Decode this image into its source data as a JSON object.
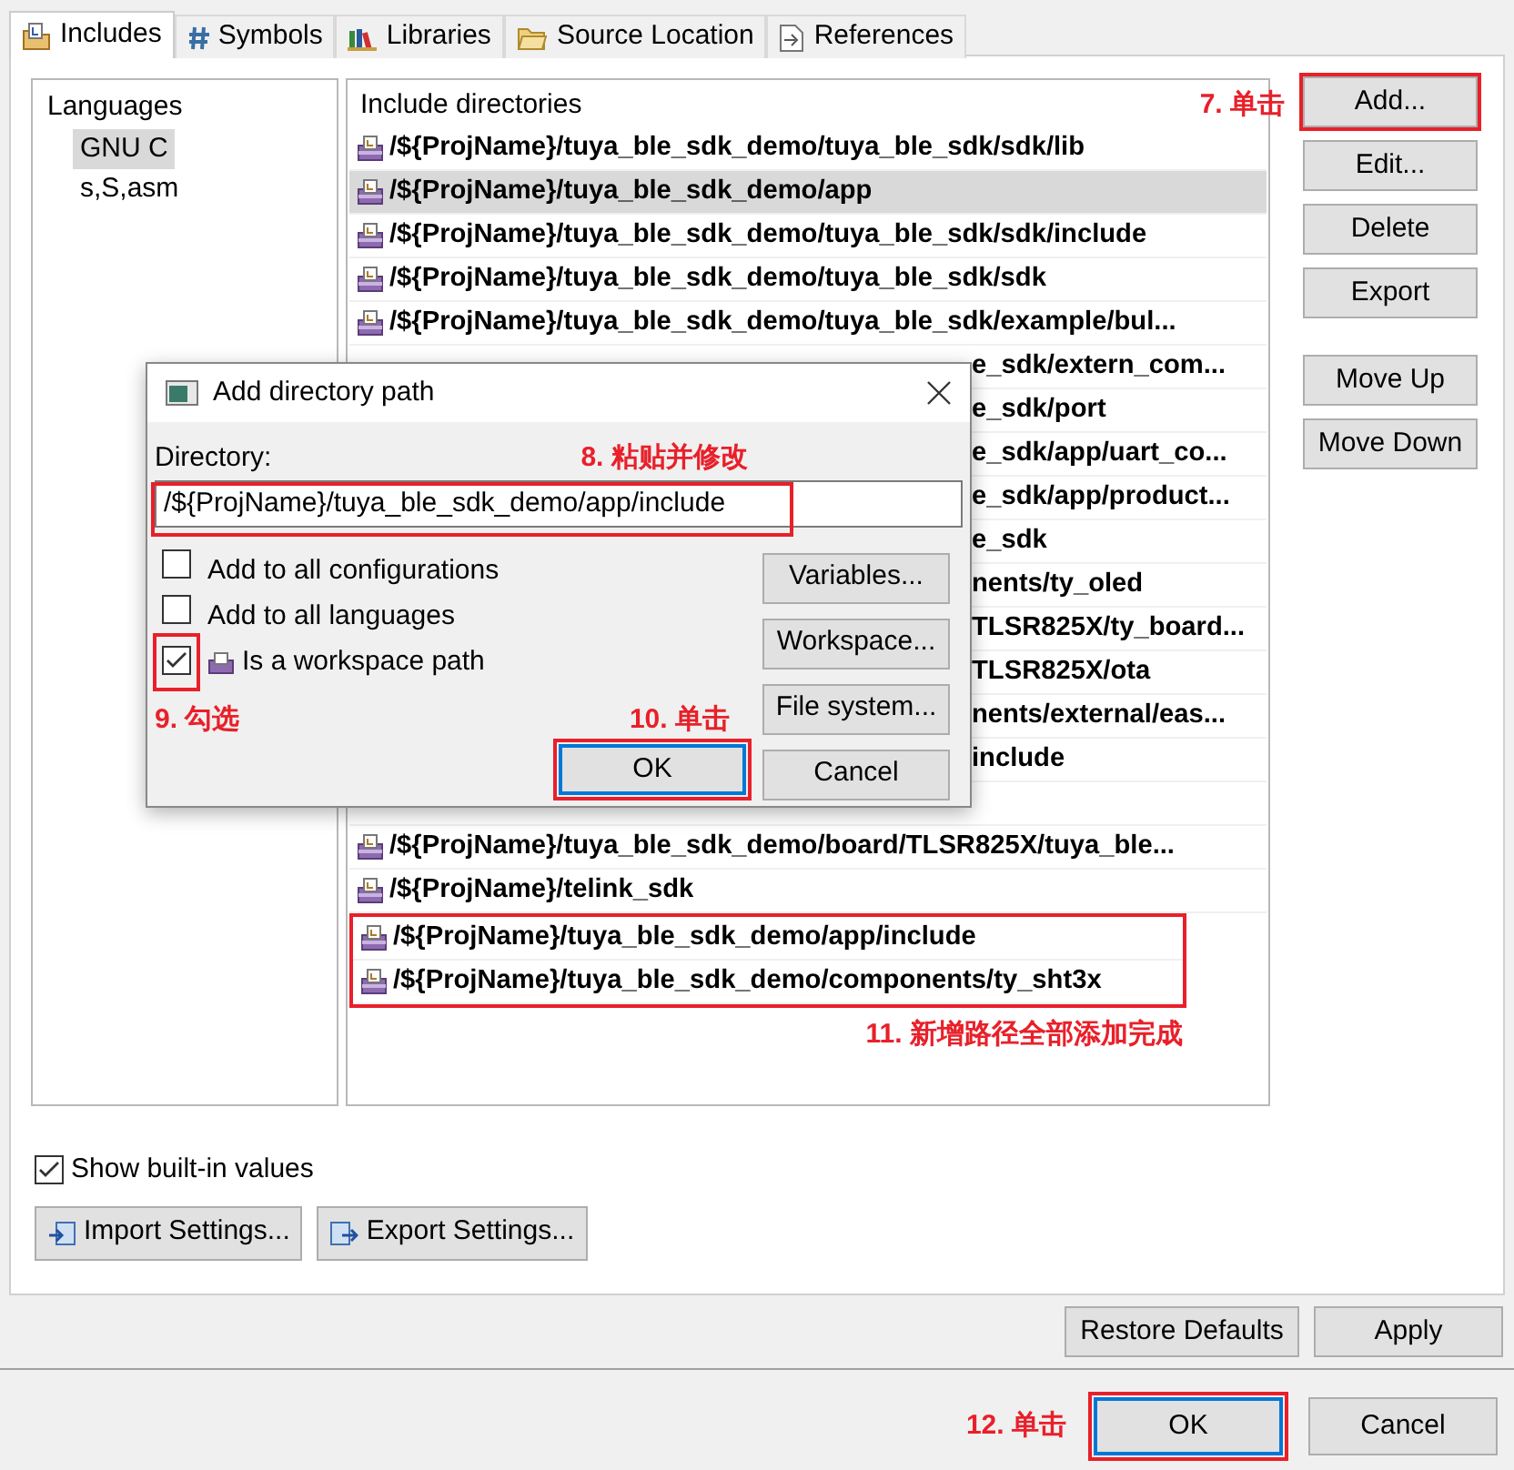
{
  "tabs": [
    {
      "label": "Includes",
      "selected": true
    },
    {
      "label": "Symbols",
      "selected": false
    },
    {
      "label": "Libraries",
      "selected": false
    },
    {
      "label": "Source Location",
      "selected": false
    },
    {
      "label": "References",
      "selected": false
    }
  ],
  "languages": {
    "title": "Languages",
    "items": [
      {
        "label": "GNU C",
        "selected": true
      },
      {
        "label": "s,S,asm",
        "selected": false
      }
    ]
  },
  "includes": {
    "title": "Include directories",
    "note": "11. 新增路径全部添加完成",
    "rows": [
      {
        "kind": "full",
        "path": "/${ProjName}/tuya_ble_sdk_demo/tuya_ble_sdk/sdk/lib",
        "selected": false,
        "annotated": false
      },
      {
        "kind": "full",
        "path": "/${ProjName}/tuya_ble_sdk_demo/app",
        "selected": true,
        "annotated": false
      },
      {
        "kind": "full",
        "path": "/${ProjName}/tuya_ble_sdk_demo/tuya_ble_sdk/sdk/include",
        "selected": false,
        "annotated": false
      },
      {
        "kind": "full",
        "path": "/${ProjName}/tuya_ble_sdk_demo/tuya_ble_sdk/sdk",
        "selected": false,
        "annotated": false
      },
      {
        "kind": "full",
        "path": "/${ProjName}/tuya_ble_sdk_demo/tuya_ble_sdk/example/bul...",
        "selected": false,
        "annotated": false
      },
      {
        "kind": "partial",
        "path": "e_sdk/extern_com...",
        "selected": false,
        "annotated": false
      },
      {
        "kind": "partial",
        "path": "e_sdk/port",
        "selected": false,
        "annotated": false
      },
      {
        "kind": "partial",
        "path": "e_sdk/app/uart_co...",
        "selected": false,
        "annotated": false
      },
      {
        "kind": "partial",
        "path": "e_sdk/app/product...",
        "selected": false,
        "annotated": false
      },
      {
        "kind": "partial",
        "path": "e_sdk",
        "selected": false,
        "annotated": false
      },
      {
        "kind": "partial",
        "path": "nents/ty_oled",
        "selected": false,
        "annotated": false
      },
      {
        "kind": "partial",
        "path": "TLSR825X/ty_board...",
        "selected": false,
        "annotated": false
      },
      {
        "kind": "partial",
        "path": "TLSR825X/ota",
        "selected": false,
        "annotated": false
      },
      {
        "kind": "partial",
        "path": "nents/external/eas...",
        "selected": false,
        "annotated": false
      },
      {
        "kind": "partial",
        "path": "include",
        "selected": false,
        "annotated": false
      },
      {
        "kind": "covered",
        "annotated": false
      },
      {
        "kind": "full",
        "path": "/${ProjName}/tuya_ble_sdk_demo/board/TLSR825X/tuya_ble...",
        "selected": false,
        "annotated": false
      },
      {
        "kind": "full",
        "path": "/${ProjName}/telink_sdk",
        "selected": false,
        "annotated": false
      },
      {
        "kind": "full",
        "path": "/${ProjName}/tuya_ble_sdk_demo/app/include",
        "selected": false,
        "annotated": true
      },
      {
        "kind": "full",
        "path": "/${ProjName}/tuya_ble_sdk_demo/components/ty_sht3x",
        "selected": false,
        "annotated": true
      }
    ]
  },
  "side_buttons": [
    {
      "label": "Add...",
      "annotated": true,
      "note": "7. 单击"
    },
    {
      "label": "Edit...",
      "annotated": false
    },
    {
      "label": "Delete",
      "annotated": false
    },
    {
      "label": "Export",
      "annotated": false
    },
    {
      "label": "Move Up",
      "annotated": false
    },
    {
      "label": "Move Down",
      "annotated": false
    }
  ],
  "dialog": {
    "title": "Add directory path",
    "directory_label": "Directory:",
    "directory_value": "/${ProjName}/tuya_ble_sdk_demo/app/include",
    "directory_annotated": true,
    "directory_note": "8. 粘贴并修改",
    "options": [
      {
        "kind": "plain",
        "label": "Add to all configurations",
        "checked": false,
        "annotated": false
      },
      {
        "kind": "plain",
        "label": "Add to all languages",
        "checked": false,
        "annotated": false
      },
      {
        "kind": "workspace",
        "label": "Is a workspace path",
        "checked": true,
        "annotated": true,
        "note": "9. 勾选"
      }
    ],
    "side_buttons": [
      "Variables...",
      "Workspace...",
      "File system..."
    ],
    "ok": {
      "label": "OK",
      "annotated": true,
      "note": "10. 单击"
    },
    "cancel": "Cancel"
  },
  "show_builtin": {
    "label": "Show built-in values",
    "checked": true
  },
  "settings_buttons": [
    "Import Settings...",
    "Export Settings..."
  ],
  "footer_buttons": [
    "Restore Defaults",
    "Apply"
  ],
  "dialog_buttons": [
    {
      "label": "OK",
      "default": true,
      "annotated": true,
      "note": "12. 单击"
    },
    {
      "label": "Cancel",
      "default": false,
      "annotated": false
    }
  ]
}
